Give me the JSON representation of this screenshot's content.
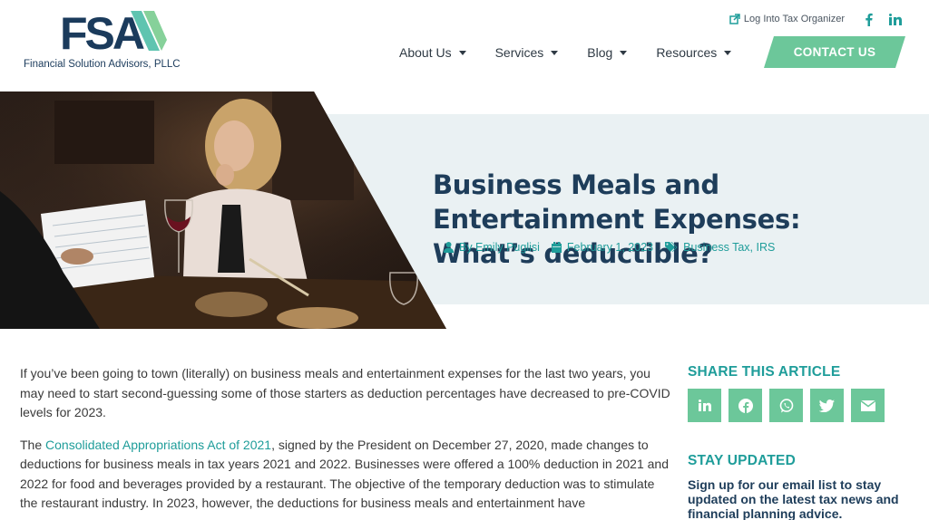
{
  "header": {
    "logo_letters": "FSA",
    "logo_text": "Financial Solution Advisors, PLLC",
    "util_link": "Log Into Tax Organizer",
    "nav": [
      {
        "label": "About Us"
      },
      {
        "label": "Services"
      },
      {
        "label": "Blog"
      },
      {
        "label": "Resources"
      }
    ],
    "contact": "CONTACT US"
  },
  "hero": {
    "title": "Business Meals and Entertainment Expenses: What’s deductible?",
    "author": "By Emily Puglisi",
    "date": "February 1, 2023",
    "tags": "Business Tax, IRS"
  },
  "article": {
    "p1": "If you’ve been going to town (literally) on business meals and entertainment expenses for the last two years, you may need to start second-guessing some of those starters as deduction percentages have decreased to pre-COVID levels for 2023.",
    "p2_prefix": "The ",
    "p2_link": "Consolidated Appropriations Act of 2021",
    "p2_rest": ", signed by the President on December 27, 2020, made changes to deductions for business meals in tax years 2021 and 2022. Businesses were offered a 100% deduction in 2021 and 2022 for food and beverages provided by a restaurant. The objective of the temporary deduction was to stimulate the restaurant industry. In 2023, however, the deductions for business meals and entertainment have"
  },
  "sidebar": {
    "share_heading": "SHARE THIS ARTICLE",
    "share_buttons": [
      "linkedin-icon",
      "facebook-icon",
      "whatsapp-icon",
      "twitter-icon",
      "email-icon"
    ],
    "stay_heading": "STAY UPDATED",
    "stay_text": "Sign up for our email list to stay updated on the latest tax news and financial planning advice."
  },
  "colors": {
    "navy": "#1e3d5a",
    "teal": "#1f9d9a",
    "green": "#6cc79a",
    "hero_bg": "#eaf1f3"
  }
}
